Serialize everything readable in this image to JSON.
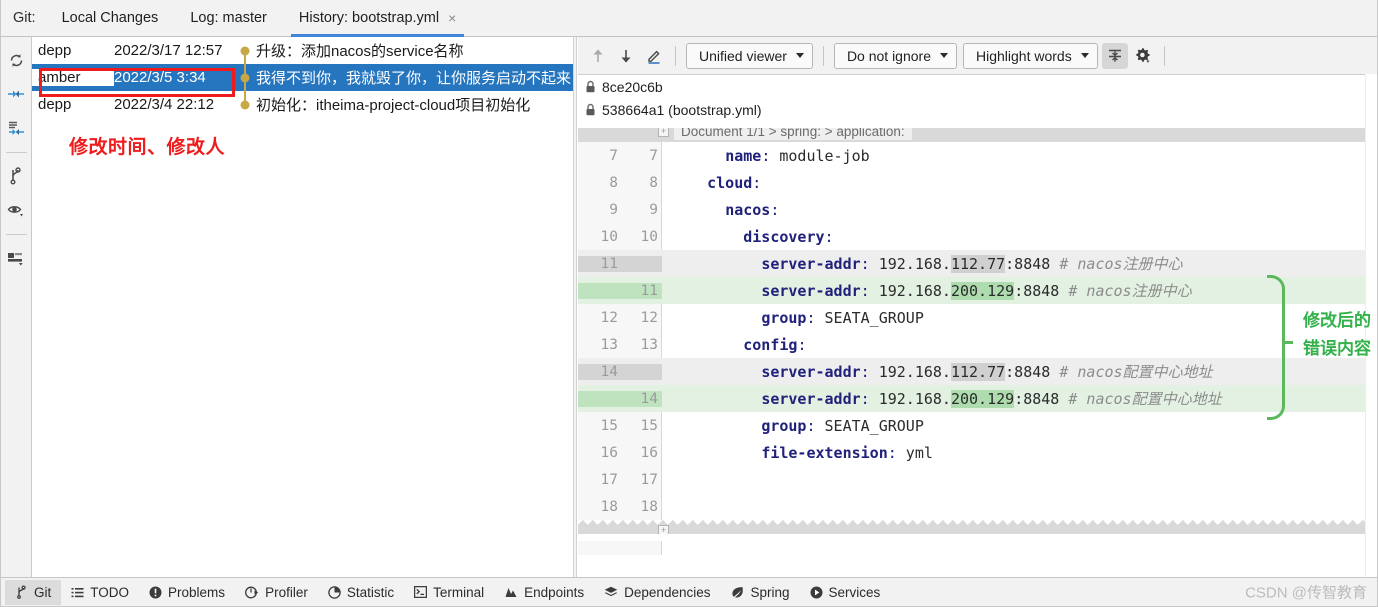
{
  "tabbar": {
    "git_label": "Git:",
    "tabs": [
      {
        "label": "Local Changes",
        "active": false
      },
      {
        "label": "Log: master",
        "active": false
      },
      {
        "label": "History: bootstrap.yml",
        "active": true,
        "close": "×"
      }
    ]
  },
  "rail": {
    "icons": [
      {
        "name": "refresh-icon"
      },
      {
        "name": "collapse-all-icon"
      },
      {
        "name": "expand-collapse-icon"
      },
      {
        "name": "branch-icon"
      },
      {
        "name": "eye-icon"
      },
      {
        "name": "layout-icon"
      }
    ]
  },
  "commit_list": {
    "rows": [
      {
        "author": "depp",
        "date": "2022/3/17 12:57",
        "subject": "升级：添加nacos的service名称",
        "selected": false
      },
      {
        "author": "amber",
        "date": "2022/3/5 3:34",
        "subject": "我得不到你，我就毁了你，让你服务启动不起来",
        "selected": true
      },
      {
        "author": "depp",
        "date": "2022/3/4 22:12",
        "subject": "初始化：itheima-project-cloud项目初始化",
        "selected": false
      }
    ]
  },
  "annotations": {
    "red_text": "修改时间、修改人",
    "red_color": "#ee1c1c",
    "green_line1": "修改后的",
    "green_line2": "错误内容",
    "green_color": "#33b14a"
  },
  "diff_toolbar": {
    "prev_diff": "previous-difference-icon",
    "next_diff": "next-difference-icon",
    "edit": "edit-source-icon",
    "viewer_mode": "Unified viewer",
    "whitespace": "Do not ignore",
    "highlight": "Highlight words",
    "collapse_unchanged": "collapse-unchanged-fragments-icon",
    "settings": "gear-icon"
  },
  "revisions": [
    {
      "label": "8ce20c6b",
      "icon": "lock-icon"
    },
    {
      "label": "538664a1 (bootstrap.yml)",
      "icon": "lock-icon"
    }
  ],
  "code": {
    "breadcrumb": "Document 1/1 > spring: > application:",
    "expand_glyph": "+",
    "lines": [
      {
        "old": "7",
        "new": "7",
        "type": "ctx",
        "indent": 6,
        "key": "name",
        "value": " module-job"
      },
      {
        "old": "8",
        "new": "8",
        "type": "ctx",
        "indent": 4,
        "key": "cloud",
        "value": ""
      },
      {
        "old": "9",
        "new": "9",
        "type": "ctx",
        "indent": 6,
        "key": "nacos",
        "value": ""
      },
      {
        "old": "10",
        "new": "10",
        "type": "ctx",
        "indent": 8,
        "key": "discovery",
        "value": ""
      },
      {
        "old": "11",
        "new": "",
        "type": "del",
        "indent": 10,
        "key": "server-addr",
        "pre": " 192.168.",
        "hl": "112.77",
        "post": ":8848 ",
        "comment": "# nacos注册中心"
      },
      {
        "old": "",
        "new": "11",
        "type": "ins",
        "indent": 10,
        "key": "server-addr",
        "pre": " 192.168.",
        "hl": "200.129",
        "post": ":8848 ",
        "comment": "# nacos注册中心"
      },
      {
        "old": "12",
        "new": "12",
        "type": "ctx",
        "indent": 10,
        "key": "group",
        "value": " SEATA_GROUP"
      },
      {
        "old": "13",
        "new": "13",
        "type": "ctx",
        "indent": 8,
        "key": "config",
        "value": ""
      },
      {
        "old": "14",
        "new": "",
        "type": "del",
        "indent": 10,
        "key": "server-addr",
        "pre": " 192.168.",
        "hl": "112.77",
        "post": ":8848 ",
        "comment": "# nacos配置中心地址"
      },
      {
        "old": "",
        "new": "14",
        "type": "ins",
        "indent": 10,
        "key": "server-addr",
        "pre": " 192.168.",
        "hl": "200.129",
        "post": ":8848 ",
        "comment": "# nacos配置中心地址"
      },
      {
        "old": "15",
        "new": "15",
        "type": "ctx",
        "indent": 10,
        "key": "group",
        "value": " SEATA_GROUP"
      },
      {
        "old": "16",
        "new": "16",
        "type": "ctx",
        "indent": 10,
        "key": "file-extension",
        "value": " yml"
      },
      {
        "old": "17",
        "new": "17",
        "type": "ctx",
        "indent": 0,
        "key": "",
        "value": ""
      },
      {
        "old": "18",
        "new": "18",
        "type": "ctx",
        "indent": 0,
        "key": "",
        "value": ""
      }
    ]
  },
  "statusbar": {
    "items": [
      {
        "label": "Git",
        "icon": "branch-icon",
        "active": true
      },
      {
        "label": "TODO",
        "icon": "list-icon",
        "active": false
      },
      {
        "label": "Problems",
        "icon": "error-icon",
        "active": false
      },
      {
        "label": "Profiler",
        "icon": "profiler-icon",
        "active": false
      },
      {
        "label": "Statistic",
        "icon": "pie-icon",
        "active": false
      },
      {
        "label": "Terminal",
        "icon": "terminal-icon",
        "active": false
      },
      {
        "label": "Endpoints",
        "icon": "endpoints-icon",
        "active": false
      },
      {
        "label": "Dependencies",
        "icon": "layers-icon",
        "active": false
      },
      {
        "label": "Spring",
        "icon": "leaf-icon",
        "active": false
      },
      {
        "label": "Services",
        "icon": "play-icon",
        "active": false
      }
    ],
    "watermark": "CSDN @传智教育"
  }
}
